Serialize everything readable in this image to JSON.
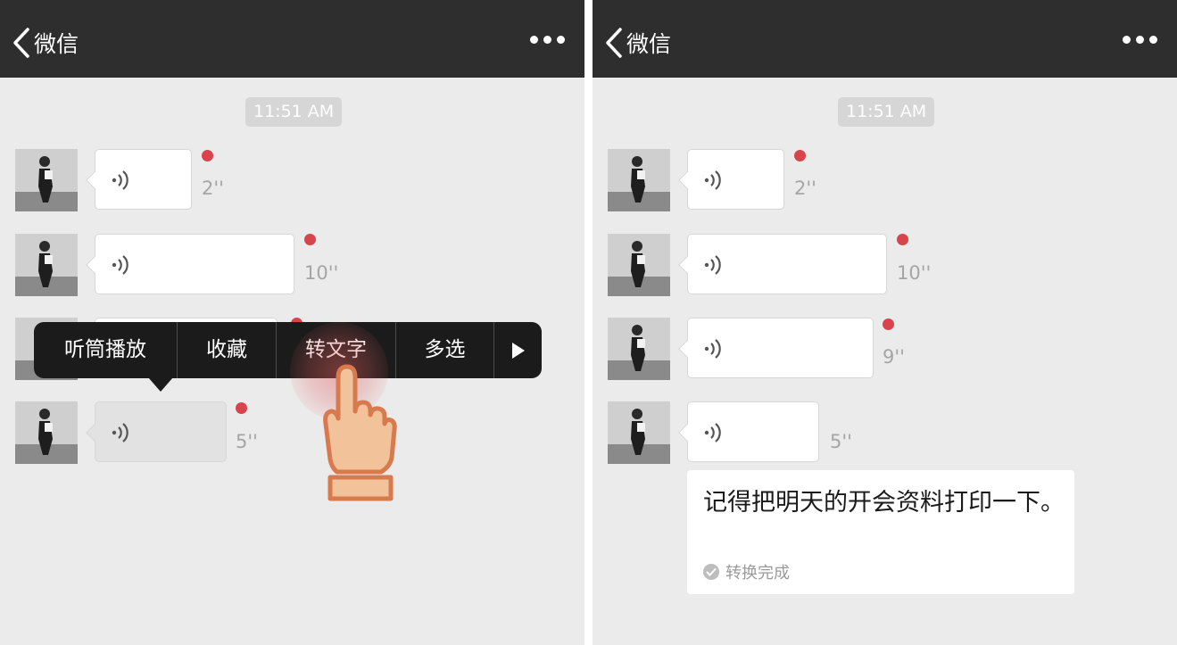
{
  "left": {
    "nav": {
      "back_label": "微信",
      "more_icon": "more-dots-icon"
    },
    "time": "11:51 AM",
    "messages": [
      {
        "duration": "2''"
      },
      {
        "duration": "10''"
      },
      {
        "duration": ""
      },
      {
        "duration": "5''"
      }
    ],
    "context_menu": {
      "items": [
        "听筒播放",
        "收藏",
        "转文字",
        "多选"
      ],
      "more_icon": "play-triangle-icon"
    }
  },
  "right": {
    "nav": {
      "back_label": "微信",
      "more_icon": "more-dots-icon"
    },
    "time": "11:51 AM",
    "messages": [
      {
        "duration": "2''"
      },
      {
        "duration": "10''"
      },
      {
        "duration": "9''"
      },
      {
        "duration": "5''"
      }
    ],
    "transcription": {
      "text": "记得把明天的开会资料打印一下。",
      "status": "转换完成"
    }
  },
  "colors": {
    "navbar": "#2e2e2e",
    "chat_background": "#ebebeb",
    "unread_dot": "#d9434b",
    "menu_background": "#1b1b1b"
  }
}
